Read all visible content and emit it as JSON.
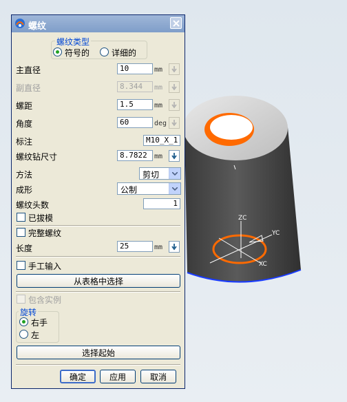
{
  "dialog": {
    "title": "螺纹",
    "thread_type": {
      "legend": "螺纹类型",
      "symbolic": "符号的",
      "detailed": "详细的",
      "selected": "symbolic"
    },
    "fields": {
      "major_diameter": {
        "label": "主直径",
        "value": "10",
        "unit": "mm"
      },
      "minor_diameter": {
        "label": "副直径",
        "value": "8.344",
        "unit": "mm"
      },
      "pitch": {
        "label": "螺距",
        "value": "1.5",
        "unit": "mm"
      },
      "angle": {
        "label": "角度",
        "value": "60",
        "unit": "deg"
      },
      "callout": {
        "label": "标注",
        "value": "M10_X_1."
      },
      "tap_drill_size": {
        "label": "螺纹钻尺寸",
        "value": "8.7822",
        "unit": "mm"
      }
    },
    "method": {
      "label": "方法",
      "value": "剪切"
    },
    "form": {
      "label": "成形",
      "value": "公制"
    },
    "num_starts": {
      "label": "螺纹头数",
      "value": "1"
    },
    "tapered": {
      "label": "已拔模",
      "checked": false
    },
    "full_thread": {
      "label": "完整螺纹",
      "checked": false
    },
    "length": {
      "label": "长度",
      "value": "25",
      "unit": "mm"
    },
    "manual_input": {
      "label": "手工输入",
      "checked": false
    },
    "choose_from_table_label": "从表格中选择",
    "include_instances": {
      "label": "包含实例",
      "checked": false
    },
    "rotation": {
      "legend": "旋转",
      "right": "右手",
      "left": "左",
      "selected": "right"
    },
    "select_start_label": "选择起始",
    "ok_label": "确定",
    "apply_label": "应用",
    "cancel_label": "取消"
  },
  "viewport": {
    "csys_labels": {
      "zc": "ZC",
      "yc": "YC",
      "xc": "XC"
    },
    "colors": {
      "body": "#4a4a4a",
      "face_top": "#d8d8d8",
      "hole_edge": "#ff6a00",
      "edge_blue": "#1a3cff"
    }
  }
}
